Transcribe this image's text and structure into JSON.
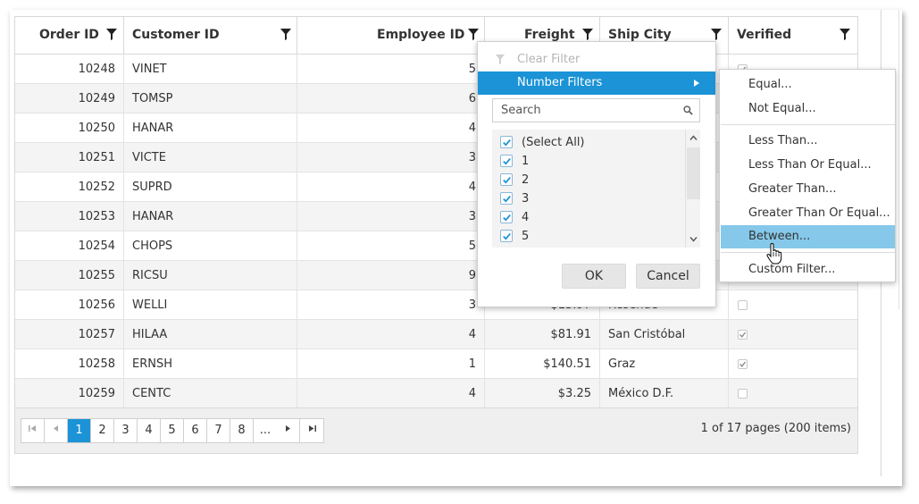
{
  "grid": {
    "columns": [
      {
        "label": "Order ID"
      },
      {
        "label": "Customer ID"
      },
      {
        "label": "Employee ID"
      },
      {
        "label": "Freight"
      },
      {
        "label": "Ship City"
      },
      {
        "label": "Verified"
      }
    ],
    "rows": [
      {
        "order_id": "10248",
        "customer_id": "VINET",
        "employee_id": "5",
        "freight": "",
        "ship_city": "",
        "verified": true
      },
      {
        "order_id": "10249",
        "customer_id": "TOMSP",
        "employee_id": "6",
        "freight": "",
        "ship_city": "",
        "verified": false
      },
      {
        "order_id": "10250",
        "customer_id": "HANAR",
        "employee_id": "4",
        "freight": "",
        "ship_city": "",
        "verified": false
      },
      {
        "order_id": "10251",
        "customer_id": "VICTE",
        "employee_id": "3",
        "freight": "",
        "ship_city": "",
        "verified": false
      },
      {
        "order_id": "10252",
        "customer_id": "SUPRD",
        "employee_id": "4",
        "freight": "",
        "ship_city": "",
        "verified": false
      },
      {
        "order_id": "10253",
        "customer_id": "HANAR",
        "employee_id": "3",
        "freight": "",
        "ship_city": "",
        "verified": false
      },
      {
        "order_id": "10254",
        "customer_id": "CHOPS",
        "employee_id": "5",
        "freight": "",
        "ship_city": "",
        "verified": false
      },
      {
        "order_id": "10255",
        "customer_id": "RICSU",
        "employee_id": "9",
        "freight": "",
        "ship_city": "",
        "verified": false
      },
      {
        "order_id": "10256",
        "customer_id": "WELLI",
        "employee_id": "3",
        "freight": "$13.97",
        "ship_city": "Resende",
        "verified": false
      },
      {
        "order_id": "10257",
        "customer_id": "HILAA",
        "employee_id": "4",
        "freight": "$81.91",
        "ship_city": "San Cristóbal",
        "verified": true
      },
      {
        "order_id": "10258",
        "customer_id": "ERNSH",
        "employee_id": "1",
        "freight": "$140.51",
        "ship_city": "Graz",
        "verified": true
      },
      {
        "order_id": "10259",
        "customer_id": "CENTC",
        "employee_id": "4",
        "freight": "$3.25",
        "ship_city": "México D.F.",
        "verified": false
      }
    ]
  },
  "pager": {
    "pages": [
      "1",
      "2",
      "3",
      "4",
      "5",
      "6",
      "7",
      "8",
      "..."
    ],
    "current_page": "1",
    "info": "1 of 17 pages (200 items)"
  },
  "filter_menu": {
    "clear_filter": "Clear Filter",
    "number_filters": "Number Filters",
    "search_placeholder": "Search",
    "values": [
      "(Select All)",
      "1",
      "2",
      "3",
      "4",
      "5"
    ],
    "ok_label": "OK",
    "cancel_label": "Cancel"
  },
  "number_filter_submenu": {
    "items": [
      "Equal...",
      "Not Equal...",
      "Less Than...",
      "Less Than Or Equal...",
      "Greater Than...",
      "Greater Than Or Equal...",
      "Between...",
      "Custom Filter..."
    ],
    "highlighted": "Between..."
  },
  "colors": {
    "accent": "#1b93d6",
    "highlight": "#85c8ea",
    "alt_row": "#f4f4f4",
    "border": "#d8d8d8"
  }
}
